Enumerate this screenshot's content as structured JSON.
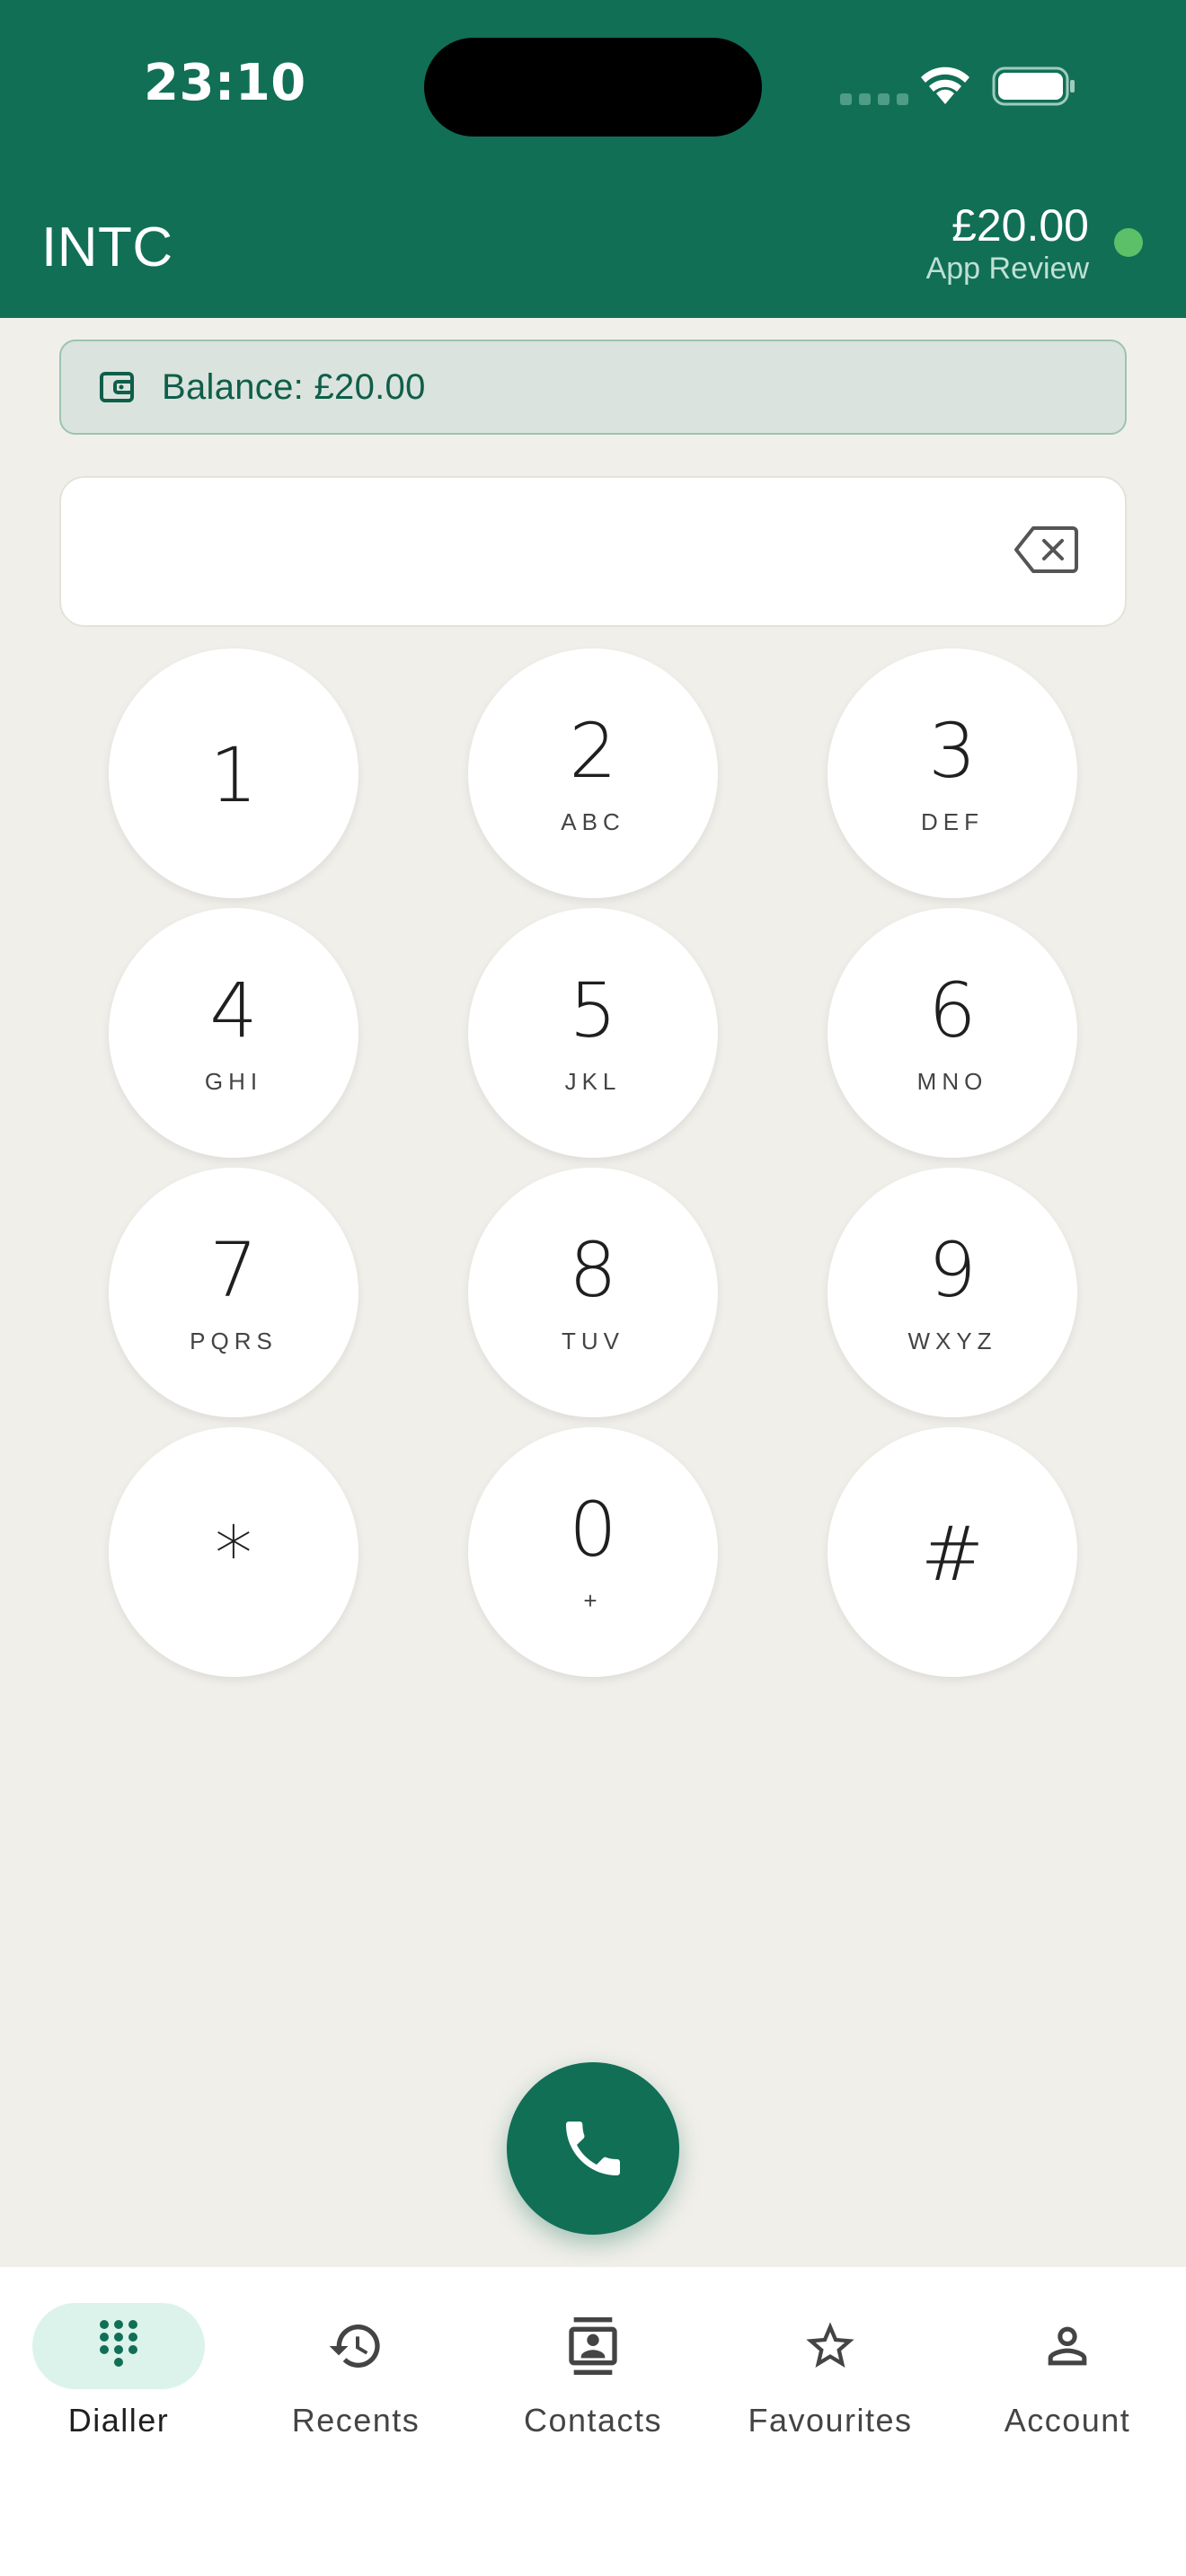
{
  "status_bar": {
    "time": "23:10"
  },
  "header": {
    "title": "INTC",
    "balance": "£20.00",
    "account_label": "App Review",
    "online_color": "#5cc069"
  },
  "banner": {
    "text": "Balance: £20.00",
    "icon": "wallet-icon"
  },
  "dialer": {
    "number": "",
    "keys": [
      {
        "digit": "1",
        "letters": ""
      },
      {
        "digit": "2",
        "letters": "ABC"
      },
      {
        "digit": "3",
        "letters": "DEF"
      },
      {
        "digit": "4",
        "letters": "GHI"
      },
      {
        "digit": "5",
        "letters": "JKL"
      },
      {
        "digit": "6",
        "letters": "MNO"
      },
      {
        "digit": "7",
        "letters": "PQRS"
      },
      {
        "digit": "8",
        "letters": "TUV"
      },
      {
        "digit": "9",
        "letters": "WXYZ"
      },
      {
        "digit": "*",
        "letters": ""
      },
      {
        "digit": "0",
        "letters": "+"
      },
      {
        "digit": "#",
        "letters": ""
      }
    ]
  },
  "nav": {
    "items": [
      {
        "label": "Dialler",
        "icon": "dialpad-icon",
        "active": true
      },
      {
        "label": "Recents",
        "icon": "history-icon",
        "active": false
      },
      {
        "label": "Contacts",
        "icon": "contacts-icon",
        "active": false
      },
      {
        "label": "Favourites",
        "icon": "star-icon",
        "active": false
      },
      {
        "label": "Account",
        "icon": "person-icon",
        "active": false
      }
    ]
  },
  "colors": {
    "brand": "#116f56",
    "background": "#f1efea",
    "active_nav": "#dcf3ec"
  }
}
